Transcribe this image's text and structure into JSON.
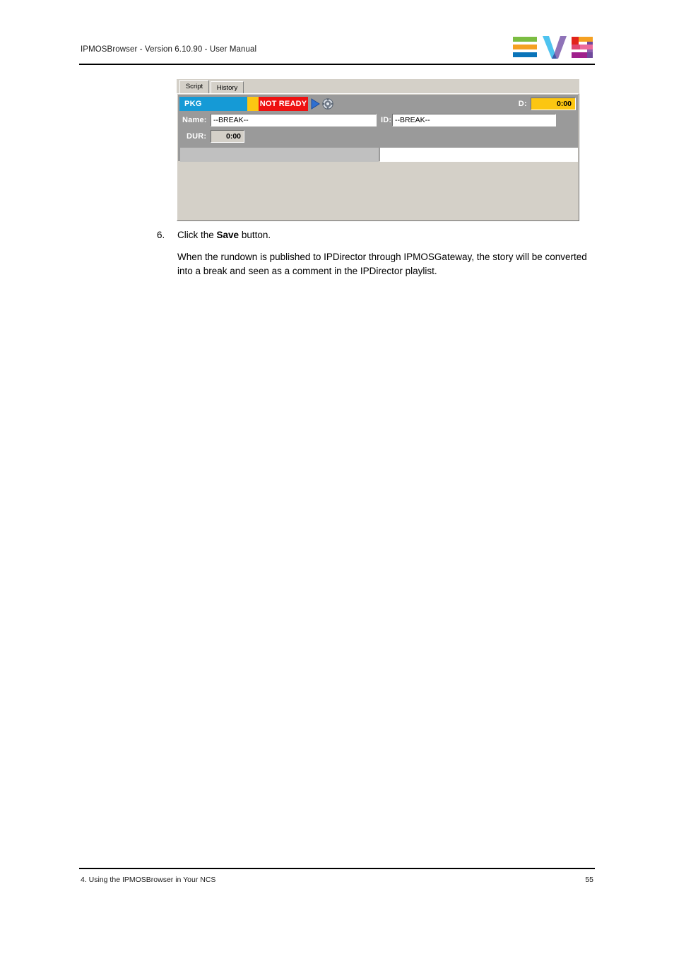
{
  "header": {
    "title": "IPMOSBrowser - Version 6.10.90 - User Manual",
    "logo_alt": "EVS"
  },
  "screenshot": {
    "tabs": [
      {
        "label": "Script",
        "active": true
      },
      {
        "label": "History",
        "active": false
      }
    ],
    "status_bar": {
      "type_badge": "PKG",
      "state_badge": "NOT READY",
      "play_icon": "play-triangle-icon",
      "settings_icon": "gear-icon",
      "duration_label": "D:",
      "duration_value": "0:00"
    },
    "fields": {
      "name_label": "Name:",
      "name_value": "--BREAK--",
      "id_label": "ID:",
      "id_value": "--BREAK--",
      "dur_label": "DUR:",
      "dur_value": "0:00"
    },
    "colors": {
      "pkg_blue": "#159ad6",
      "accent_yellow": "#fcc612",
      "not_ready_red": "#ee1111",
      "panel_face": "#d4d0c8",
      "row_background": "#9a9a9a"
    }
  },
  "instructions": {
    "step_number": "6.",
    "step_text_before": "Click the ",
    "step_text_bold": "Save",
    "step_text_after": " button.",
    "step_body": "When the rundown is published to IPDirector through IPMOSGateway, the story will be converted into a break and seen as a comment in the IPDirector playlist."
  },
  "footer": {
    "chapter": "4. Using the IPMOSBrowser in Your NCS",
    "page_number": "55"
  }
}
